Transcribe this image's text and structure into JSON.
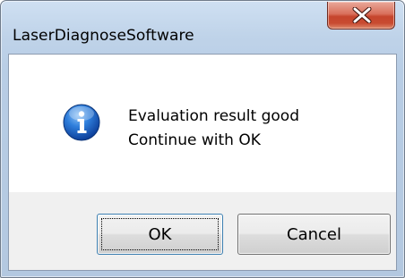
{
  "window": {
    "title": "LaserDiagnoseSoftware"
  },
  "titlebar": {
    "close_icon": "close-x-icon"
  },
  "message": {
    "icon": "info-icon",
    "line1": "Evaluation result good",
    "line2": "Continue with OK"
  },
  "buttons": {
    "ok_label": "OK",
    "cancel_label": "Cancel"
  },
  "colors": {
    "close_button": "#c84b31",
    "info_icon": "#1a63c6",
    "default_button_border": "#3c7fb1"
  }
}
